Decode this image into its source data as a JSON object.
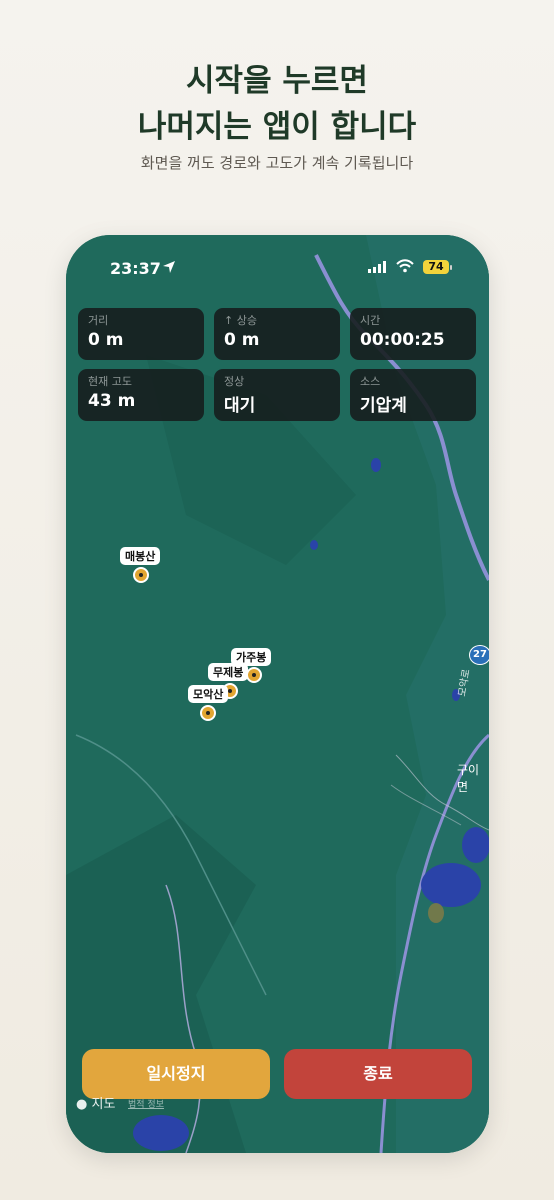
{
  "header": {
    "title_line1": "시작을 누르면",
    "title_line2": "나머지는 앱이 합니다",
    "subtitle": "화면을 꺼도 경로와 고도가 계속 기록됩니다"
  },
  "status_bar": {
    "time": "23:37",
    "battery": "74"
  },
  "stats": [
    {
      "label": "거리",
      "value": "0 m"
    },
    {
      "label": "↑ 상승",
      "value": "0 m"
    },
    {
      "label": "시간",
      "value": "00:00:25"
    },
    {
      "label": "현재 고도",
      "value": "43 m"
    },
    {
      "label": "정상",
      "value": "대기"
    },
    {
      "label": "소스",
      "value": "기압계"
    }
  ],
  "map": {
    "peaks": [
      "매봉산",
      "가주봉",
      "무제봉",
      "모악산"
    ],
    "route_number": "27",
    "town": "구이면",
    "road_name": "모악로",
    "legal": "지도",
    "legal_link": "법적 정보"
  },
  "actions": {
    "pause": "일시정지",
    "end": "종료"
  },
  "colors": {
    "map_green": "#1f6b5e",
    "pause": "#e2a63d",
    "end": "#c2443b",
    "peak_marker": "#e2a531",
    "route_badge": "#2a6fb8"
  }
}
